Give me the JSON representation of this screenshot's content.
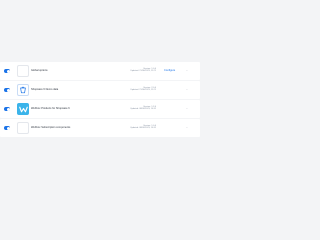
{
  "plugins": [
    {
      "logo_icon": "blank-plugin-icon",
      "name": "Global options",
      "version": "Version: 1.0.0",
      "updated": "Updated: 21/06/2023, 11:21",
      "action_label": "Configure",
      "more_label": "..."
    },
    {
      "logo_icon": "shopping-bag-icon",
      "name": "Shopware 6 Demo data",
      "version": "Version: 2.0.0",
      "updated": "Updated: 21/06/2023, 11:21",
      "more_label": "..."
    },
    {
      "logo_icon": "w-logo-icon",
      "name": "Webhox Products for Shopware 6",
      "version": "Version: 1.3.0",
      "updated": "Updated: 08/06/2023, 10:31",
      "more_label": "..."
    },
    {
      "logo_icon": "blank-plugin-icon",
      "name": "Webhox Subscription components",
      "version": "Version: 1.0.0",
      "updated": "Updated: 08/06/2023, 10:31",
      "more_label": "..."
    }
  ],
  "colors": {
    "accent": "#1a73e8",
    "background": "#f3f4f6",
    "card": "#ffffff",
    "logo_w": "#3bb4ea"
  }
}
